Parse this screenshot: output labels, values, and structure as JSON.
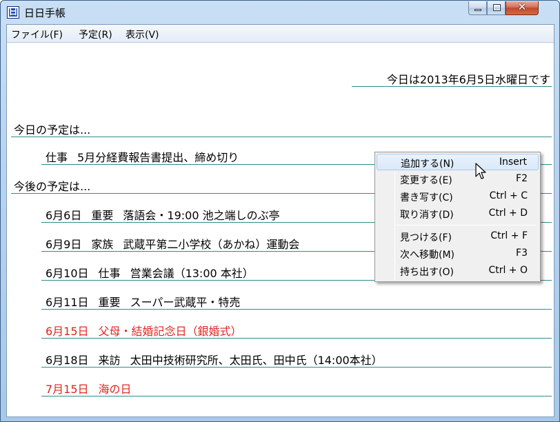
{
  "window": {
    "title": "日日手帳",
    "icon_glyph": "日",
    "controls": {
      "minimize": "minimize-icon",
      "maximize": "maximize-icon",
      "close_glyph": "✕"
    }
  },
  "menubar": {
    "items": [
      "ファイル(F)",
      "予定(R)",
      "表示(V)"
    ]
  },
  "today": "今日は2013年6月5日水曜日です",
  "sections": {
    "today_heading": "今日の予定は...",
    "upcoming_heading": "今後の予定は..."
  },
  "today_entries": [
    {
      "date": "",
      "category": "仕事",
      "text": "5月分経費報告書提出、締め切り",
      "holiday": false
    }
  ],
  "upcoming_entries": [
    {
      "date": "6月6日",
      "category": "重要",
      "text": "落語会・19:00 池之端しのぶ亭",
      "holiday": false
    },
    {
      "date": "6月9日",
      "category": "家族",
      "text": "武蔵平第二小学校（あかね）運動会",
      "holiday": false
    },
    {
      "date": "6月10日",
      "category": "仕事",
      "text": "営業会議（13:00 本社）",
      "holiday": false
    },
    {
      "date": "6月11日",
      "category": "重要",
      "text": "スーパー武蔵平・特売",
      "holiday": false
    },
    {
      "date": "6月15日",
      "category": "父母・結婚記念日（銀婚式）",
      "text": "",
      "holiday": true
    },
    {
      "date": "6月18日",
      "category": "来訪",
      "text": "太田中技術研究所、太田氏、田中氏（14:00本社）",
      "holiday": false
    },
    {
      "date": "7月15日",
      "category": "海の日",
      "text": "",
      "holiday": true
    }
  ],
  "context_menu": {
    "items": [
      {
        "label": "追加する(N)",
        "shortcut": "Insert",
        "highlighted": true
      },
      {
        "label": "変更する(E)",
        "shortcut": "F2"
      },
      {
        "label": "書き写す(C)",
        "shortcut": "Ctrl + C"
      },
      {
        "label": "取り消す(D)",
        "shortcut": "Ctrl + D"
      },
      {
        "label": "見つける(F)",
        "shortcut": "Ctrl + F"
      },
      {
        "label": "次へ移動(M)",
        "shortcut": "F3"
      },
      {
        "label": "持ち出す(O)",
        "shortcut": "Ctrl + O"
      }
    ]
  },
  "colors": {
    "rule_line": "#2e8a8a",
    "holiday_text": "#e0241c",
    "menu_highlight": "#d9e8f9"
  }
}
